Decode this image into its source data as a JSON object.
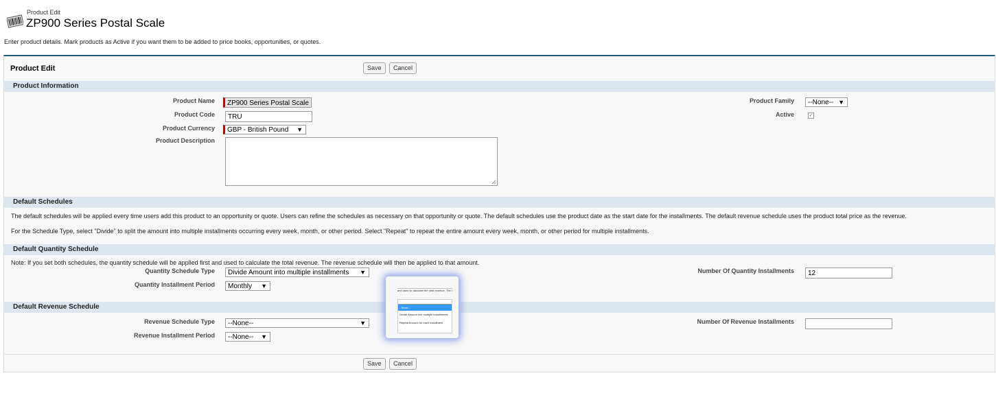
{
  "header": {
    "breadcrumb": "Product Edit",
    "title": "ZP900 Series Postal Scale",
    "intro": "Enter product details. Mark products as Active if you want them to be added to price books, opportunities, or quotes."
  },
  "panel": {
    "title": "Product Edit",
    "save_label": "Save",
    "cancel_label": "Cancel"
  },
  "product_information": {
    "section_title": "Product Information",
    "product_name_label": "Product Name",
    "product_name_value": "ZP900 Series Postal Scale",
    "product_code_label": "Product Code",
    "product_code_value": "TRU",
    "product_currency_label": "Product Currency",
    "product_currency_value": "GBP - British Pound",
    "product_description_label": "Product Description",
    "product_description_value": "",
    "product_family_label": "Product Family",
    "product_family_value": "--None--",
    "active_label": "Active",
    "active_checked": true
  },
  "default_schedules": {
    "section_title": "Default Schedules",
    "paragraph1": "The default schedules will be applied every time users add this product to an opportunity or quote. Users can refine the schedules as necessary on that opportunity or quote. The default schedules use the product date as the start date for the installments. The default revenue schedule uses the product total price as the revenue.",
    "paragraph2": "For the Schedule Type, select \"Divide\" to split the amount into multiple installments occurring every week, month, or other period. Select \"Repeat\" to repeat the entire amount every week, month, or other period for multiple installments."
  },
  "quantity_schedule": {
    "section_title": "Default Quantity Schedule",
    "note": "Note: If you set both schedules, the quantity schedule will be applied first and used to calculate the total revenue. The revenue schedule will then be applied to that amount.",
    "type_label": "Quantity Schedule Type",
    "type_value": "Divide Amount into multiple installments",
    "period_label": "Quantity Installment Period",
    "period_value": "Monthly",
    "installments_label": "Number Of Quantity Installments",
    "installments_value": "12"
  },
  "revenue_schedule": {
    "section_title": "Default Revenue Schedule",
    "type_label": "Revenue Schedule Type",
    "type_value": "--None--",
    "period_label": "Revenue Installment Period",
    "period_value": "--None--",
    "installments_label": "Number Of Revenue Installments",
    "installments_value": ""
  },
  "popup": {
    "caption": "and used to calculate the total revenue. The reve",
    "options": [
      "--None--",
      "Divide Amount into multiple installments",
      "Repeat Amount for each installment"
    ]
  },
  "icons": {
    "product": "barcode-icon",
    "caret": "▼",
    "check": "✓"
  },
  "colors": {
    "section_bar": "#dde6ee",
    "panel_border": "#1f5d7a",
    "required": "#cc0000",
    "selected_option": "#3399ff"
  }
}
